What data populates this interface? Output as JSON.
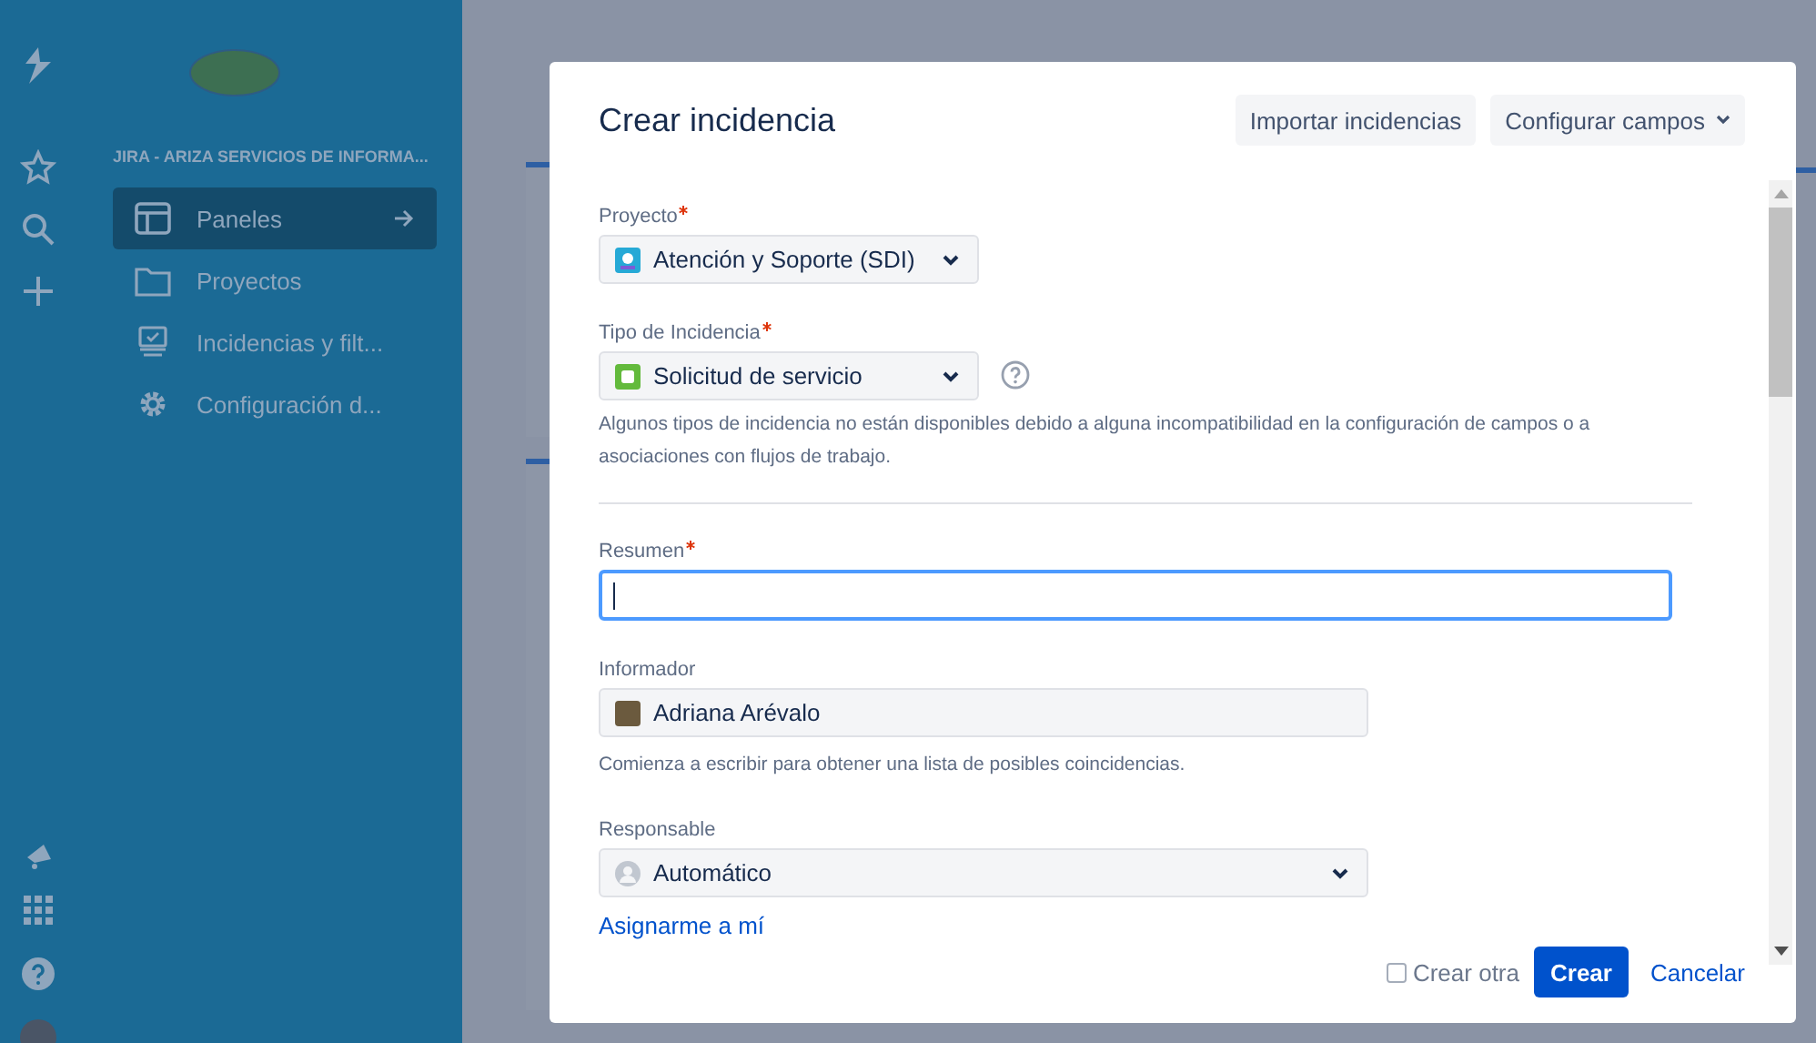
{
  "sidebar": {
    "site_title": "JIRA - ARIZA SERVICIOS DE INFORMA...",
    "items": [
      {
        "label": "Paneles",
        "selected": true
      },
      {
        "label": "Proyectos",
        "selected": false
      },
      {
        "label": "Incidencias y filt...",
        "selected": false
      },
      {
        "label": "Configuración d...",
        "selected": false
      }
    ]
  },
  "dialog": {
    "title": "Crear incidencia",
    "header_buttons": [
      {
        "label": "Importar incidencias",
        "kind": "plain"
      },
      {
        "label": "Configurar campos",
        "kind": "dropdown"
      }
    ],
    "project": {
      "label": "Proyecto",
      "required": true,
      "value": "Atención y Soporte (SDI)"
    },
    "issue_type": {
      "label": "Tipo de Incidencia",
      "required": true,
      "value": "Solicitud de servicio",
      "hint": "Algunos tipos de incidencia no están disponibles debido a alguna incompatibilidad en la configuración de campos o a asociaciones con flujos de trabajo."
    },
    "summary": {
      "label": "Resumen",
      "required": true,
      "focused": true
    },
    "reporter": {
      "label": "Informador",
      "value": "Adriana Arévalo",
      "hint": "Comienza a escribir para obtener una lista de posibles coincidencias."
    },
    "assignee": {
      "label": "Responsable",
      "value": "Automático",
      "link": "Asignarme a mí"
    },
    "footer": {
      "create_another": {
        "label": "Crear otra",
        "checked": false
      },
      "submit": "Crear",
      "cancel": "Cancelar"
    }
  }
}
